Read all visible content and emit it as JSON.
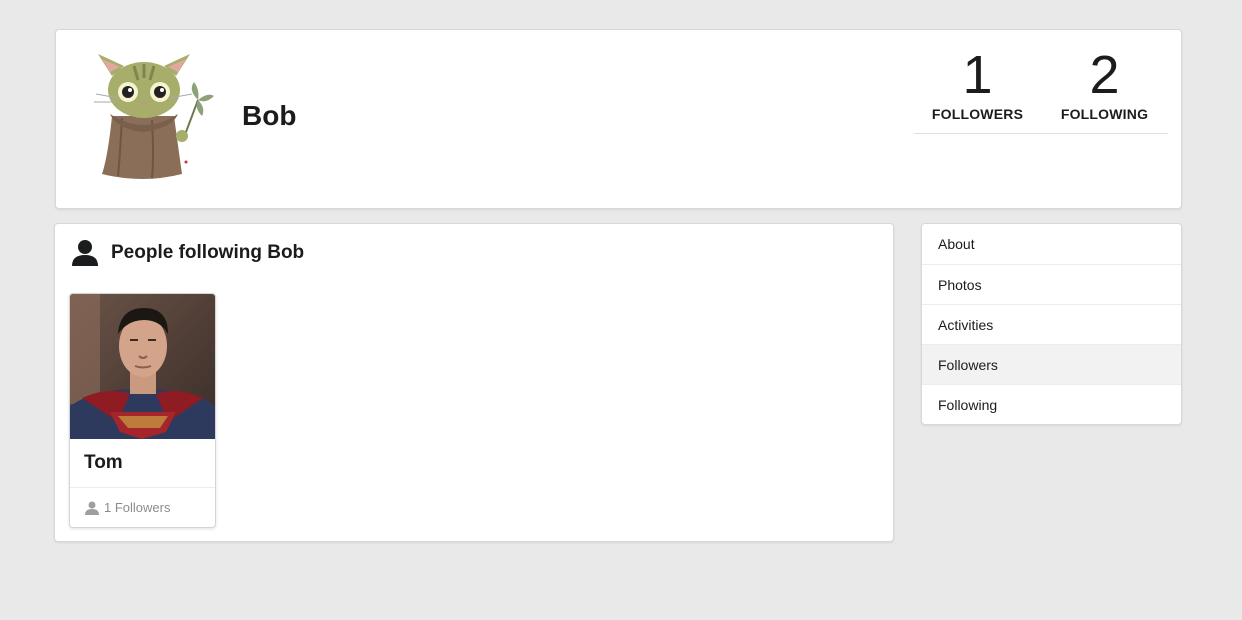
{
  "profile": {
    "name": "Bob",
    "stats": {
      "followers_count": "1",
      "followers_label": "FOLLOWERS",
      "following_count": "2",
      "following_label": "FOLLOWING"
    }
  },
  "followers_panel": {
    "title": "People following Bob",
    "icon": "user-icon",
    "cards": [
      {
        "name": "Tom",
        "followers_text": "1 Followers"
      }
    ]
  },
  "menu": {
    "items": [
      {
        "label": "About"
      },
      {
        "label": "Photos"
      },
      {
        "label": "Activities"
      },
      {
        "label": "Followers"
      },
      {
        "label": "Following"
      }
    ],
    "active": "Followers"
  },
  "colors": {
    "background": "#e9e9e9",
    "card": "#ffffff",
    "active_menu_bg": "#f2f2f2",
    "muted_text": "#8c8c8c"
  }
}
